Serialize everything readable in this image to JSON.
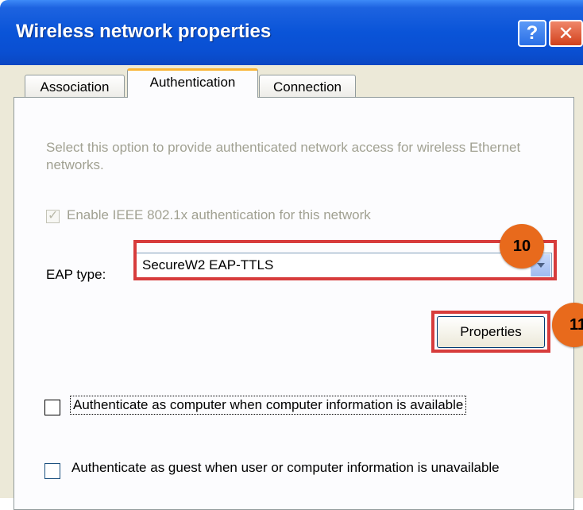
{
  "window": {
    "title": "Wireless network properties",
    "help_label": "?",
    "close_label": "✕"
  },
  "tabs": [
    {
      "label": "Association",
      "active": false
    },
    {
      "label": "Authentication",
      "active": true
    },
    {
      "label": "Connection",
      "active": false
    }
  ],
  "authentication": {
    "description": "Select this option to provide authenticated network access for wireless Ethernet networks.",
    "enable_8021x": {
      "label": "Enable IEEE 802.1x authentication for this network",
      "checked": true,
      "disabled": true
    },
    "eap_type": {
      "label": "EAP type:",
      "value": "SecureW2 EAP-TTLS"
    },
    "properties_button": "Properties",
    "auth_as_computer": {
      "label": "Authenticate as computer when computer information is available",
      "checked": false
    },
    "auth_as_guest": {
      "label": "Authenticate as guest when user or computer information is unavailable",
      "checked": false
    }
  },
  "annotations": {
    "badge_eap": "10",
    "badge_properties": "11"
  },
  "colors": {
    "titlebar": "#0a54d8",
    "dialog_bg": "#ece9d8",
    "highlight_box": "#d73c3c",
    "badge": "#e86a1c"
  }
}
